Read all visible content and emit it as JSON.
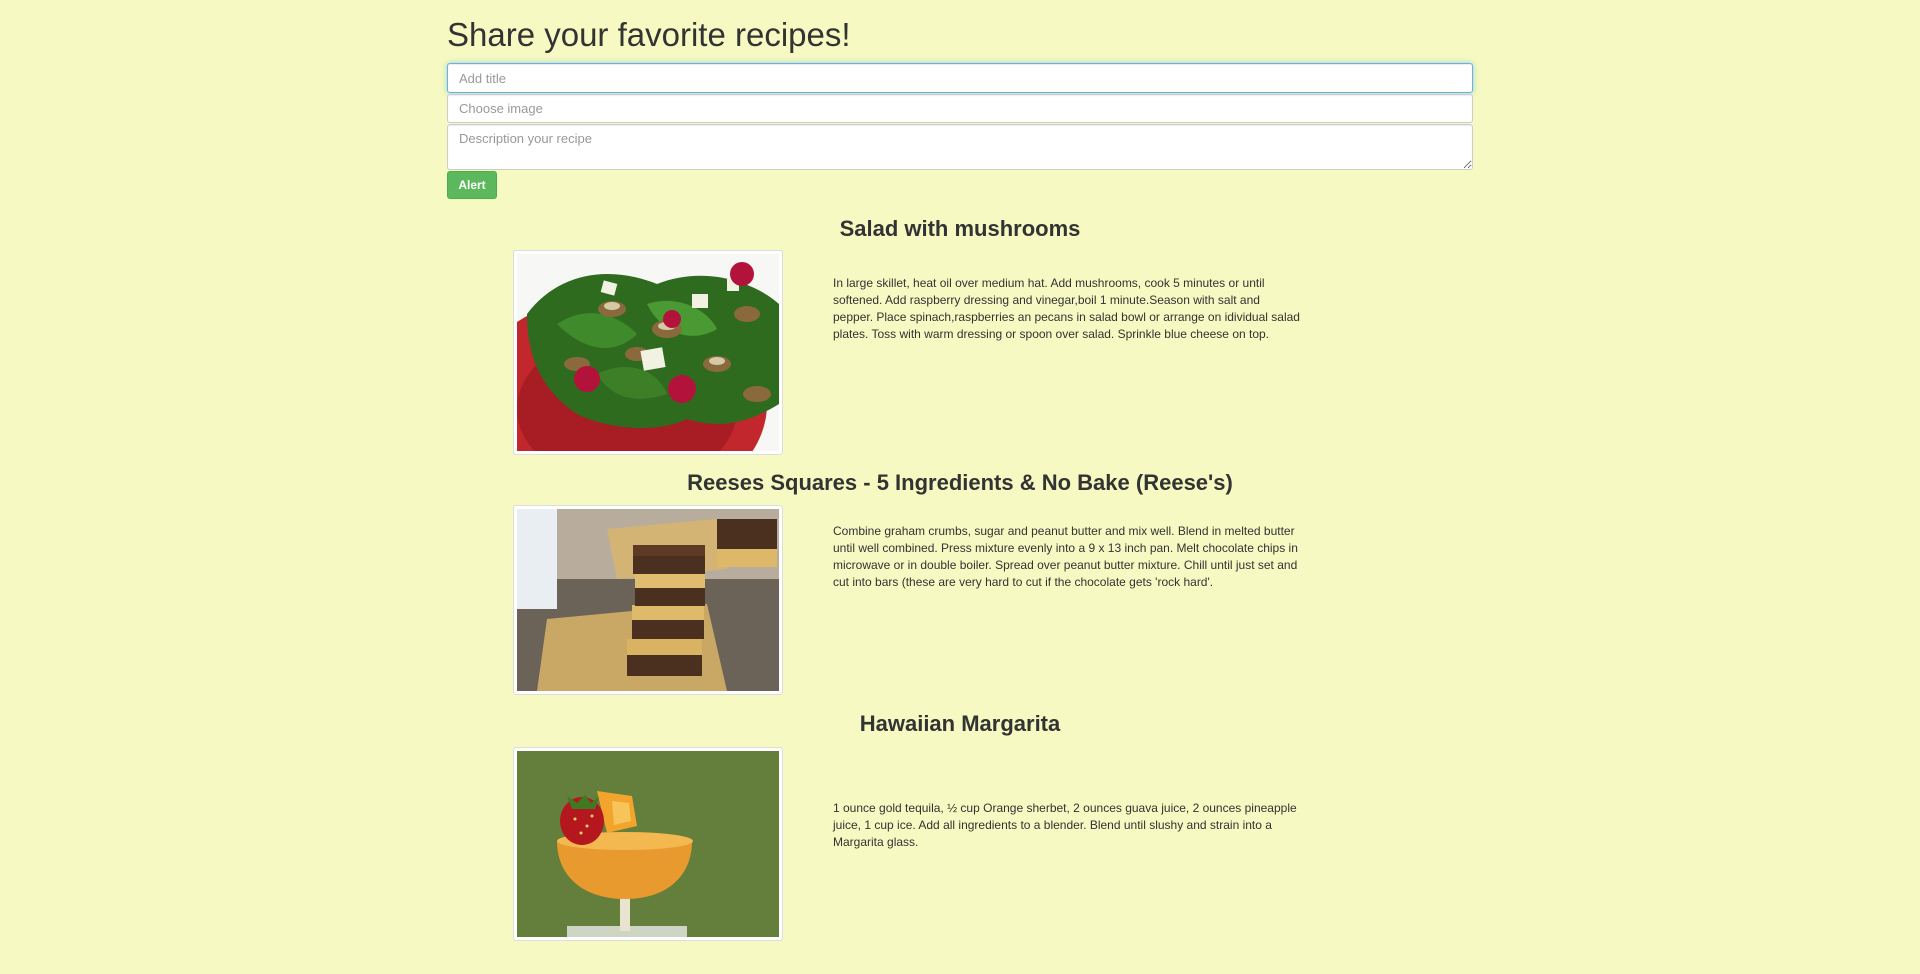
{
  "header": {
    "title": "Share your favorite recipes!"
  },
  "form": {
    "title_placeholder": "Add title",
    "title_value": "",
    "image_placeholder": "Choose image",
    "image_value": "",
    "description_placeholder": "Description your recipe",
    "description_value": "",
    "submit_label": "Alert"
  },
  "colors": {
    "page_background": "#f6f9c1",
    "button_green": "#5cb85c",
    "focus_border": "#66afe9"
  },
  "recipes": [
    {
      "title": "Salad with mushrooms",
      "description": "In large skillet, heat oil over medium hat. Add mushrooms, cook 5 minutes or until softened. Add raspberry dressing and vinegar,boil 1 minute.Season with salt and pepper. Place spinach,raspberries an pecans in salad bowl or arrange on idividual salad plates. Toss with warm dressing or spoon over salad. Sprinkle blue cheese on top.",
      "image": "salad-photo"
    },
    {
      "title": "Reeses Squares - 5 Ingredients & No Bake (Reese's)",
      "description": "Combine graham crumbs, sugar and peanut butter and mix well. Blend in melted butter until well combined. Press mixture evenly into a 9 x 13 inch pan. Melt chocolate chips in microwave or in double boiler. Spread over peanut butter mixture. Chill until just set and cut into bars (these are very hard to cut if the chocolate gets 'rock hard'.",
      "image": "reeses-squares-photo"
    },
    {
      "title": "Hawaiian Margarita",
      "description": "1 ounce gold tequila, ½ cup Orange sherbet, 2 ounces guava juice, 2 ounces pineapple juice, 1 cup ice. Add all ingredients to a blender. Blend until slushy and strain into a Margarita glass.",
      "image": "margarita-photo"
    }
  ]
}
